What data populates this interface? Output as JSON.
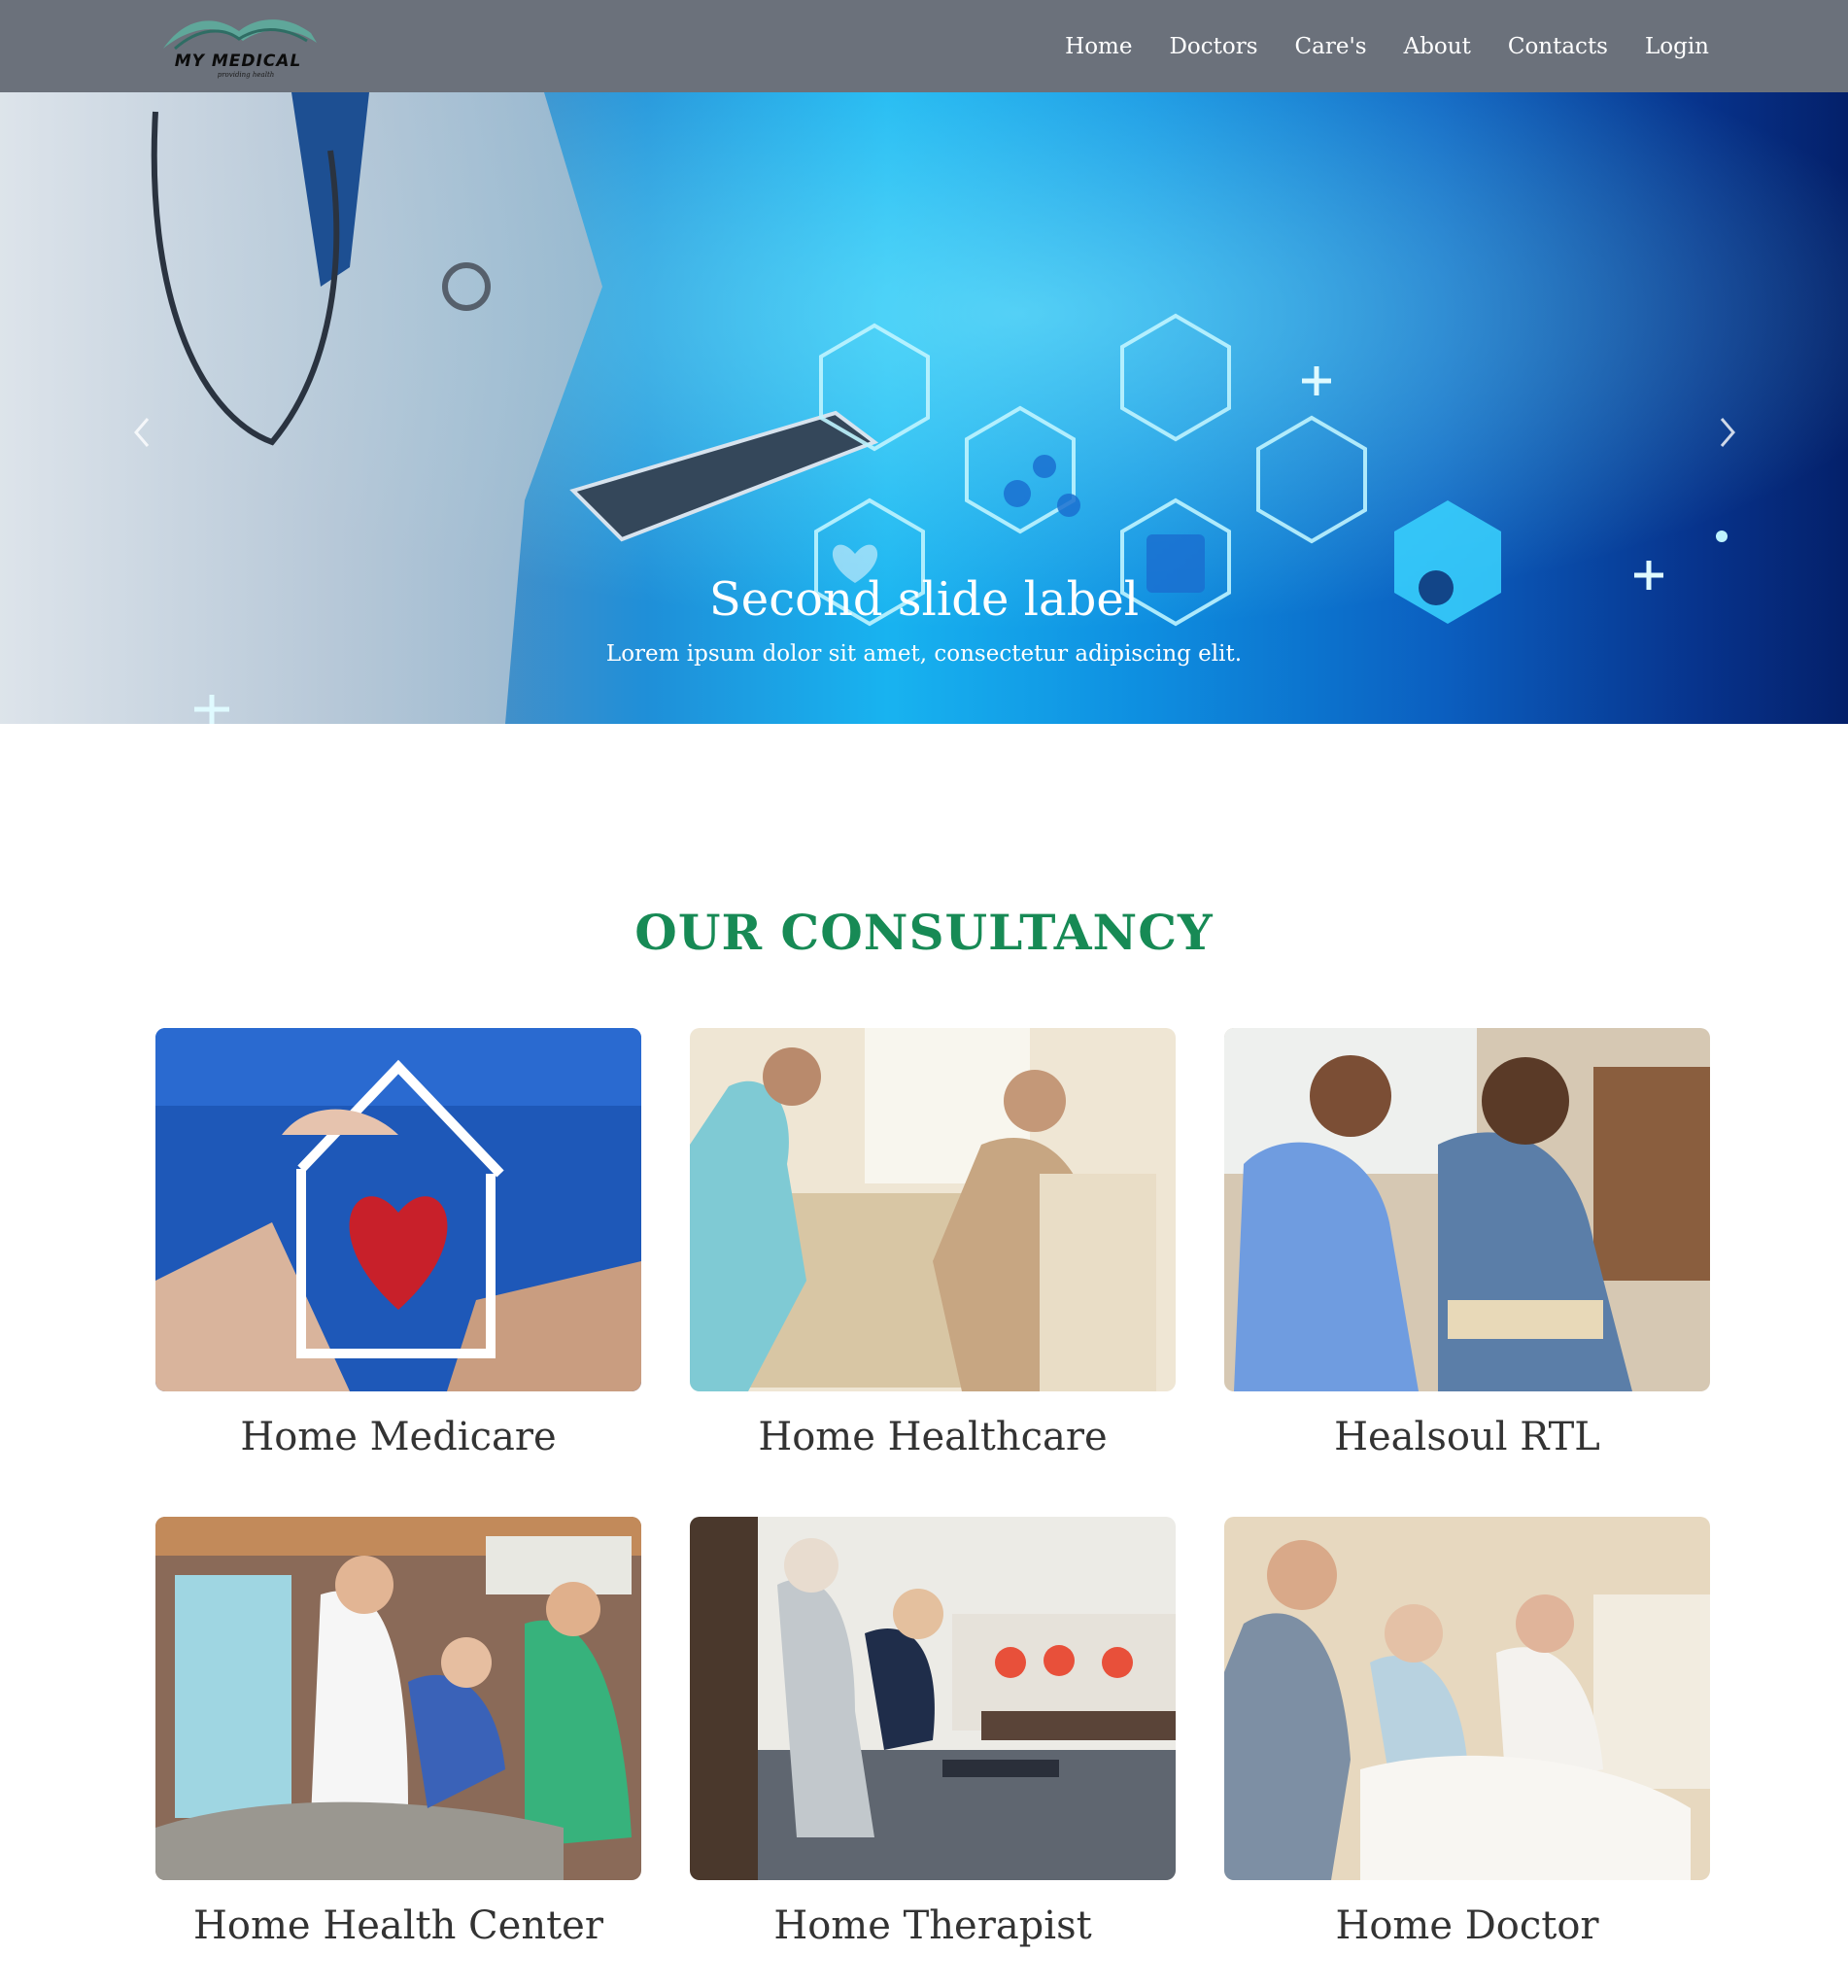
{
  "brand": {
    "name": "MY MEDICAL",
    "tagline": "providing health"
  },
  "nav": {
    "items": [
      {
        "label": "Home"
      },
      {
        "label": "Doctors"
      },
      {
        "label": "Care's"
      },
      {
        "label": "About"
      },
      {
        "label": "Contacts"
      },
      {
        "label": "Login"
      }
    ]
  },
  "hero": {
    "title": "Second slide label",
    "subtitle": "Lorem ipsum dolor sit amet, consectetur adipiscing elit.",
    "prev_icon": "chevron-left-icon",
    "next_icon": "chevron-right-icon"
  },
  "consultancy": {
    "heading": "OUR CONSULTANCY",
    "cards": [
      {
        "label": "Home Medicare"
      },
      {
        "label": "Home Healthcare"
      },
      {
        "label": "Healsoul RTL"
      },
      {
        "label": "Home Health Center"
      },
      {
        "label": "Home Therapist"
      },
      {
        "label": "Home Doctor"
      }
    ]
  },
  "colors": {
    "navbar": "#6b717b",
    "heading": "#178a55",
    "hero_blue": "#18b3f0"
  }
}
